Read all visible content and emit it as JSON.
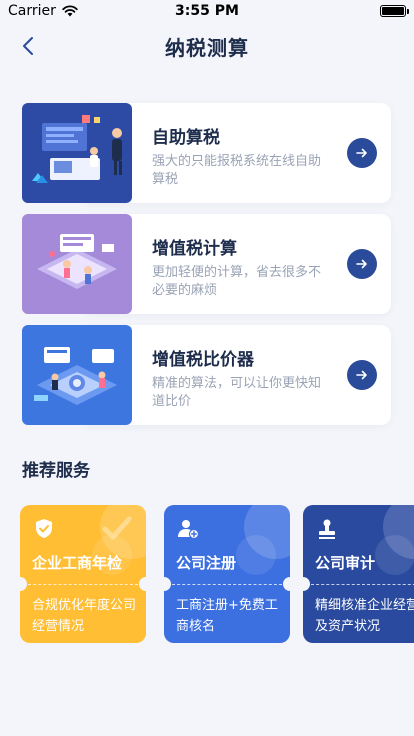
{
  "status_bar": {
    "carrier": "Carrier",
    "time": "3:55 PM"
  },
  "nav": {
    "title": "纳税测算",
    "back_icon": "chevron-left-icon"
  },
  "features": [
    {
      "title": "自助算税",
      "description": "强大的只能报税系统在线自助算税",
      "image_color": "#2d4aa4",
      "arrow_icon": "arrow-right-icon"
    },
    {
      "title": "增值税计算",
      "description": "更加轻便的计算，省去很多不必要的麻烦",
      "image_color": "#a48ad8",
      "arrow_icon": "arrow-right-icon"
    },
    {
      "title": "增值税比价器",
      "description": "精准的算法，可以让你更快知道比价",
      "image_color": "#3e76e0",
      "arrow_icon": "arrow-right-icon"
    }
  ],
  "section": {
    "title": "推荐服务"
  },
  "services": [
    {
      "title": "企业工商年检",
      "description": "合规优化年度公司经营情况",
      "color": "#ffbe34",
      "icon": "shield-check-icon"
    },
    {
      "title": "公司注册",
      "description": "工商注册+免费工商核名",
      "color": "#3c6fe0",
      "icon": "user-add-icon"
    },
    {
      "title": "公司审计",
      "description": "精细核准企业经营及资产状况",
      "color": "#2a4aa0",
      "icon": "stamp-icon"
    }
  ],
  "colors": {
    "background": "#f3f5fa",
    "accent": "#2a4a9a",
    "text": "#1f2d4d",
    "muted": "#9aa3b5"
  }
}
